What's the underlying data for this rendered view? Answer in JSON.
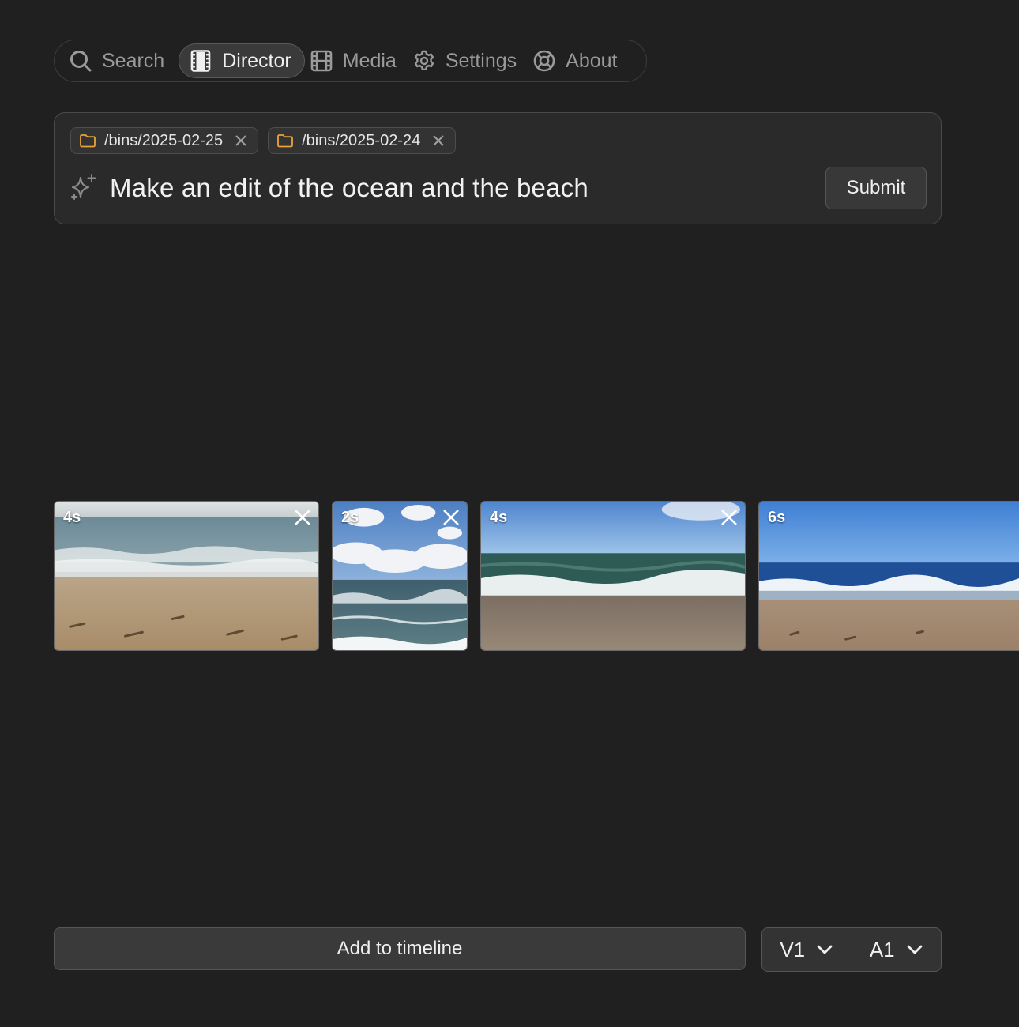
{
  "nav": {
    "items": [
      {
        "label": "Search",
        "icon": "search-icon",
        "active": false
      },
      {
        "label": "Director",
        "icon": "film-icon",
        "active": true
      },
      {
        "label": "Media",
        "icon": "film-strip-icon",
        "active": false
      },
      {
        "label": "Settings",
        "icon": "gear-icon",
        "active": false
      },
      {
        "label": "About",
        "icon": "lifebuoy-icon",
        "active": false
      }
    ]
  },
  "prompt": {
    "bins": [
      {
        "path": "/bins/2025-02-25",
        "icon": "folder-icon"
      },
      {
        "path": "/bins/2025-02-24",
        "icon": "folder-icon"
      }
    ],
    "text": "Make an edit of the ocean and the beach",
    "submit_label": "Submit"
  },
  "clips": [
    {
      "duration": "4s",
      "scene": "beach-waves"
    },
    {
      "duration": "2s",
      "scene": "clouds-sea"
    },
    {
      "duration": "4s",
      "scene": "surf-close"
    },
    {
      "duration": "6s",
      "scene": "blue-coast"
    }
  ],
  "footer": {
    "add_label": "Add to timeline",
    "video_track": "V1",
    "audio_track": "A1"
  },
  "colors": {
    "background": "#202020",
    "folder_accent": "#e8a33a",
    "panel": "#2a2a2a"
  }
}
